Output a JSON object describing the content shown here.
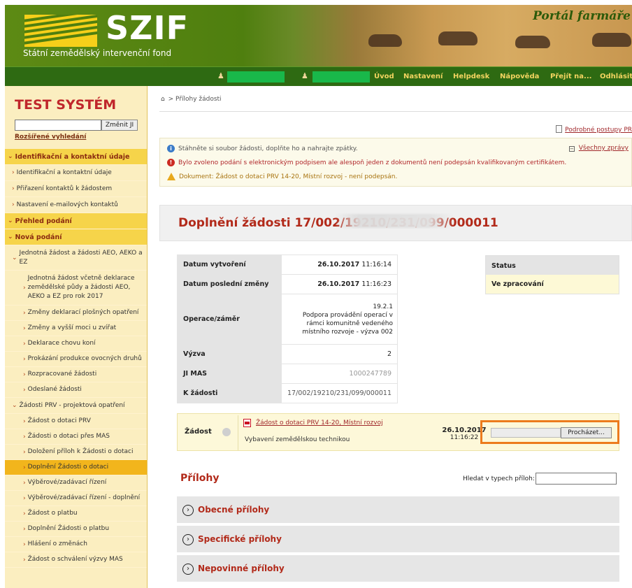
{
  "header": {
    "logo_text": "SZIF",
    "logo_subtitle": "Státní zemědělský intervenční fond",
    "portal_title": "Portál farmáře"
  },
  "nav": {
    "items": [
      "Úvod",
      "Nastavení",
      "Helpdesk",
      "Nápověda",
      "Přejít na...",
      "Odhlásit"
    ]
  },
  "sidebar": {
    "title": "TEST SYSTÉM",
    "change_button": "Změnit JI",
    "advanced_search": "Rozšířené vyhledání",
    "items": [
      {
        "label": "Identifikační a kontaktní údaje",
        "type": "section"
      },
      {
        "label": "Identifikační a kontaktní údaje",
        "type": "item"
      },
      {
        "label": "Přiřazení kontaktů k žádostem",
        "type": "item"
      },
      {
        "label": "Nastavení e-mailových kontaktů",
        "type": "item"
      },
      {
        "label": "Přehled podání",
        "type": "section"
      },
      {
        "label": "Nová podání",
        "type": "section"
      },
      {
        "label": "Jednotná žádost a žádosti AEO, AEKO a EZ",
        "type": "item"
      },
      {
        "label": "Jednotná žádost včetně deklarace zemědělské půdy a žádosti AEO, AEKO a EZ pro rok 2017",
        "type": "subitem"
      },
      {
        "label": "Změny deklarací plošných opatření",
        "type": "subitem"
      },
      {
        "label": "Změny a vyšší moci u zvířat",
        "type": "subitem"
      },
      {
        "label": "Deklarace chovu koní",
        "type": "subitem"
      },
      {
        "label": "Prokázání produkce ovocných druhů",
        "type": "subitem"
      },
      {
        "label": "Rozpracované žádosti",
        "type": "subitem"
      },
      {
        "label": "Odeslané žádosti",
        "type": "subitem"
      },
      {
        "label": "Žádosti PRV - projektová opatření",
        "type": "item"
      },
      {
        "label": "Žádost o dotaci PRV",
        "type": "subitem"
      },
      {
        "label": "Žádosti o dotaci přes MAS",
        "type": "subitem"
      },
      {
        "label": "Doložení příloh k Žádosti o dotaci",
        "type": "subitem"
      },
      {
        "label": "Doplnění Žádosti o dotaci",
        "type": "active"
      },
      {
        "label": "Výběrové/zadávací řízení",
        "type": "subitem"
      },
      {
        "label": "Výběrové/zadávací řízení - doplnění",
        "type": "subitem"
      },
      {
        "label": "Žádost o platbu",
        "type": "subitem"
      },
      {
        "label": "Doplnění Žádosti o platbu",
        "type": "subitem"
      },
      {
        "label": "Hlášení o změnách",
        "type": "subitem"
      },
      {
        "label": "Žádost o schválení výzvy MAS",
        "type": "subitem"
      }
    ]
  },
  "breadcrumb": {
    "current": "Přílohy žádosti"
  },
  "detail_link": "Podrobné postupy PR",
  "messages": {
    "info": "Stáhněte si soubor žádosti, doplňte ho a nahrajte zpátky.",
    "error": "Bylo zvoleno podání s elektronickým podpisem ale alespoň jeden z dokumentů není podepsán kvalifikovaným certifikátem.",
    "warning": "Dokument: Žádost o dotaci PRV 14-20, Místní rozvoj - není podepsán.",
    "all_link": "Všechny zprávy"
  },
  "panel": {
    "title": "Doplnění žádosti 17/002/19210/231/099/000011"
  },
  "info_table": [
    {
      "label": "Datum vytvoření",
      "value": "26.10.2017",
      "time": "11:16:14"
    },
    {
      "label": "Datum poslední změny",
      "value": "26.10.2017",
      "time": "11:16:23"
    },
    {
      "label": "Operace/záměr",
      "value": "19.2.1\nPodpora provádění operací v rámci komunitně vedeného místního rozvoje - výzva 002"
    },
    {
      "label": "Výzva",
      "value": "2"
    },
    {
      "label": "JI MAS",
      "value": "1000247789"
    },
    {
      "label": "K žádosti",
      "value": "17/002/19210/231/099/000011"
    }
  ],
  "status": {
    "header": "Status",
    "value": "Ve zpracování"
  },
  "zadost": {
    "label": "Žádost",
    "link": "Žádost o dotaci PRV 14-20, Místní rozvoj",
    "description": "Vybavení zemědělskou technikou",
    "date": "26.10.2017",
    "time": "11:16:22",
    "browse_button": "Procházet..."
  },
  "prilohy": {
    "title": "Přílohy",
    "search_label": "Hledat v typech příloh:",
    "sections": [
      "Obecné přílohy",
      "Specifické přílohy",
      "Nepovinné přílohy"
    ]
  }
}
